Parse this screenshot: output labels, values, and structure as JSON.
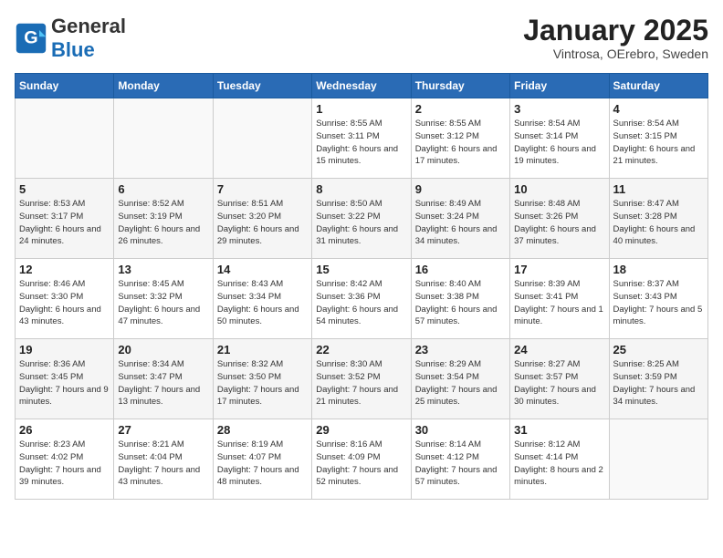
{
  "header": {
    "logo_general": "General",
    "logo_blue": "Blue",
    "month_title": "January 2025",
    "subtitle": "Vintrosa, OErebro, Sweden"
  },
  "weekdays": [
    "Sunday",
    "Monday",
    "Tuesday",
    "Wednesday",
    "Thursday",
    "Friday",
    "Saturday"
  ],
  "weeks": [
    [
      {
        "day": "",
        "info": ""
      },
      {
        "day": "",
        "info": ""
      },
      {
        "day": "",
        "info": ""
      },
      {
        "day": "1",
        "info": "Sunrise: 8:55 AM\nSunset: 3:11 PM\nDaylight: 6 hours\nand 15 minutes."
      },
      {
        "day": "2",
        "info": "Sunrise: 8:55 AM\nSunset: 3:12 PM\nDaylight: 6 hours\nand 17 minutes."
      },
      {
        "day": "3",
        "info": "Sunrise: 8:54 AM\nSunset: 3:14 PM\nDaylight: 6 hours\nand 19 minutes."
      },
      {
        "day": "4",
        "info": "Sunrise: 8:54 AM\nSunset: 3:15 PM\nDaylight: 6 hours\nand 21 minutes."
      }
    ],
    [
      {
        "day": "5",
        "info": "Sunrise: 8:53 AM\nSunset: 3:17 PM\nDaylight: 6 hours\nand 24 minutes."
      },
      {
        "day": "6",
        "info": "Sunrise: 8:52 AM\nSunset: 3:19 PM\nDaylight: 6 hours\nand 26 minutes."
      },
      {
        "day": "7",
        "info": "Sunrise: 8:51 AM\nSunset: 3:20 PM\nDaylight: 6 hours\nand 29 minutes."
      },
      {
        "day": "8",
        "info": "Sunrise: 8:50 AM\nSunset: 3:22 PM\nDaylight: 6 hours\nand 31 minutes."
      },
      {
        "day": "9",
        "info": "Sunrise: 8:49 AM\nSunset: 3:24 PM\nDaylight: 6 hours\nand 34 minutes."
      },
      {
        "day": "10",
        "info": "Sunrise: 8:48 AM\nSunset: 3:26 PM\nDaylight: 6 hours\nand 37 minutes."
      },
      {
        "day": "11",
        "info": "Sunrise: 8:47 AM\nSunset: 3:28 PM\nDaylight: 6 hours\nand 40 minutes."
      }
    ],
    [
      {
        "day": "12",
        "info": "Sunrise: 8:46 AM\nSunset: 3:30 PM\nDaylight: 6 hours\nand 43 minutes."
      },
      {
        "day": "13",
        "info": "Sunrise: 8:45 AM\nSunset: 3:32 PM\nDaylight: 6 hours\nand 47 minutes."
      },
      {
        "day": "14",
        "info": "Sunrise: 8:43 AM\nSunset: 3:34 PM\nDaylight: 6 hours\nand 50 minutes."
      },
      {
        "day": "15",
        "info": "Sunrise: 8:42 AM\nSunset: 3:36 PM\nDaylight: 6 hours\nand 54 minutes."
      },
      {
        "day": "16",
        "info": "Sunrise: 8:40 AM\nSunset: 3:38 PM\nDaylight: 6 hours\nand 57 minutes."
      },
      {
        "day": "17",
        "info": "Sunrise: 8:39 AM\nSunset: 3:41 PM\nDaylight: 7 hours\nand 1 minute."
      },
      {
        "day": "18",
        "info": "Sunrise: 8:37 AM\nSunset: 3:43 PM\nDaylight: 7 hours\nand 5 minutes."
      }
    ],
    [
      {
        "day": "19",
        "info": "Sunrise: 8:36 AM\nSunset: 3:45 PM\nDaylight: 7 hours\nand 9 minutes."
      },
      {
        "day": "20",
        "info": "Sunrise: 8:34 AM\nSunset: 3:47 PM\nDaylight: 7 hours\nand 13 minutes."
      },
      {
        "day": "21",
        "info": "Sunrise: 8:32 AM\nSunset: 3:50 PM\nDaylight: 7 hours\nand 17 minutes."
      },
      {
        "day": "22",
        "info": "Sunrise: 8:30 AM\nSunset: 3:52 PM\nDaylight: 7 hours\nand 21 minutes."
      },
      {
        "day": "23",
        "info": "Sunrise: 8:29 AM\nSunset: 3:54 PM\nDaylight: 7 hours\nand 25 minutes."
      },
      {
        "day": "24",
        "info": "Sunrise: 8:27 AM\nSunset: 3:57 PM\nDaylight: 7 hours\nand 30 minutes."
      },
      {
        "day": "25",
        "info": "Sunrise: 8:25 AM\nSunset: 3:59 PM\nDaylight: 7 hours\nand 34 minutes."
      }
    ],
    [
      {
        "day": "26",
        "info": "Sunrise: 8:23 AM\nSunset: 4:02 PM\nDaylight: 7 hours\nand 39 minutes."
      },
      {
        "day": "27",
        "info": "Sunrise: 8:21 AM\nSunset: 4:04 PM\nDaylight: 7 hours\nand 43 minutes."
      },
      {
        "day": "28",
        "info": "Sunrise: 8:19 AM\nSunset: 4:07 PM\nDaylight: 7 hours\nand 48 minutes."
      },
      {
        "day": "29",
        "info": "Sunrise: 8:16 AM\nSunset: 4:09 PM\nDaylight: 7 hours\nand 52 minutes."
      },
      {
        "day": "30",
        "info": "Sunrise: 8:14 AM\nSunset: 4:12 PM\nDaylight: 7 hours\nand 57 minutes."
      },
      {
        "day": "31",
        "info": "Sunrise: 8:12 AM\nSunset: 4:14 PM\nDaylight: 8 hours\nand 2 minutes."
      },
      {
        "day": "",
        "info": ""
      }
    ]
  ]
}
